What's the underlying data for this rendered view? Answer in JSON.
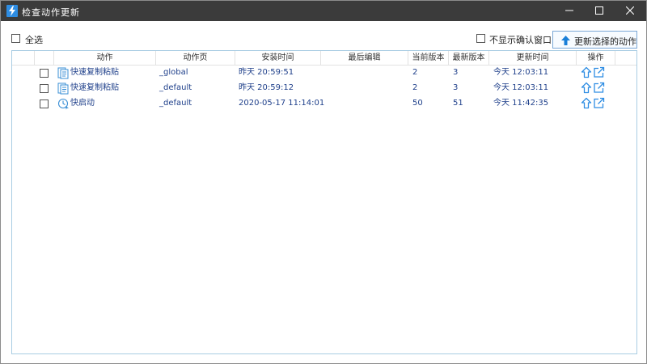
{
  "window": {
    "title": "检查动作更新",
    "controls": {
      "minimize_icon": "minimize-icon",
      "maximize_icon": "maximize-icon",
      "close_icon": "close-icon"
    }
  },
  "toolbar": {
    "select_all_label": "全选",
    "no_confirm_label": "不显示确认窗口",
    "update_button_label": "更新选择的动作",
    "update_button_icon": "arrow-up-icon"
  },
  "table": {
    "columns": [
      "动作",
      "动作页",
      "安装时间",
      "最后编辑",
      "当前版本",
      "最新版本",
      "更新时间",
      "操作"
    ],
    "rows": [
      {
        "icon": "copy-paste-icon",
        "action": "快速复制粘贴",
        "page": "_global",
        "installed": "昨天 20:59:51",
        "last_edit": "",
        "current": "2",
        "latest": "3",
        "updated": "今天 12:03:11"
      },
      {
        "icon": "copy-paste-icon",
        "action": "快速复制粘贴",
        "page": "_default",
        "installed": "昨天 20:59:12",
        "last_edit": "",
        "current": "2",
        "latest": "3",
        "updated": "今天 12:03:11"
      },
      {
        "icon": "quick-launch-icon",
        "action": "快启动",
        "page": "_default",
        "installed": "2020-05-17 11:14:01",
        "last_edit": "",
        "current": "50",
        "latest": "51",
        "updated": "今天 11:42:35"
      }
    ]
  },
  "colors": {
    "titlebar": "#3b3b3b",
    "accent": "#2e8de3",
    "link_text": "#1e3f8a",
    "table_border": "#a9cde3"
  }
}
